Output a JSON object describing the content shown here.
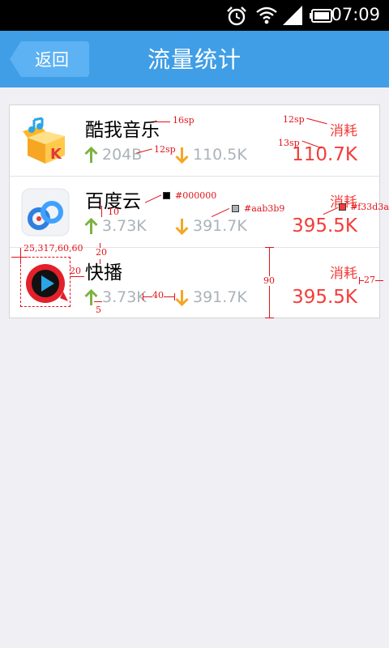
{
  "status_bar": {
    "time": "07:09",
    "icons": [
      "alarm-icon",
      "wifi-icon",
      "signal-icon",
      "battery-icon"
    ]
  },
  "title_bar": {
    "back_label": "返回",
    "title": "流量统计"
  },
  "apps": [
    {
      "name": "酷我音乐",
      "upload": "204B",
      "download": "110.5K",
      "consume_label": "消耗",
      "consume_value": "110.7K",
      "icon": "kuwo-music-icon"
    },
    {
      "name": "百度云",
      "upload": "3.73K",
      "download": "391.7K",
      "consume_label": "消耗",
      "consume_value": "395.5K",
      "icon": "baidu-cloud-icon"
    },
    {
      "name": "快播",
      "upload": "3.73K",
      "download": "391.7K",
      "consume_label": "消耗",
      "consume_value": "395.5K",
      "icon": "kuaibo-icon"
    }
  ],
  "annotations": {
    "name_size": "16sp",
    "stat_size": "12sp",
    "label_size": "12sp",
    "value_size": "13sp",
    "gap_10": "10",
    "color_black": "#000000",
    "color_gray": "#aab3b9",
    "color_red": "#f33d3a",
    "icon_rect": "25,317,60,60",
    "gap_20_left": "20",
    "gap_20_top": "20",
    "gap_40": "40",
    "gap_5": "5",
    "row_height": "90",
    "right_margin": "27"
  },
  "colors": {
    "title_bar": "#3f9ee6",
    "text_primary": "#000000",
    "text_secondary": "#aab3b9",
    "accent_red": "#f33d3a",
    "up_arrow": "#7cb342",
    "down_arrow": "#f5a623"
  }
}
